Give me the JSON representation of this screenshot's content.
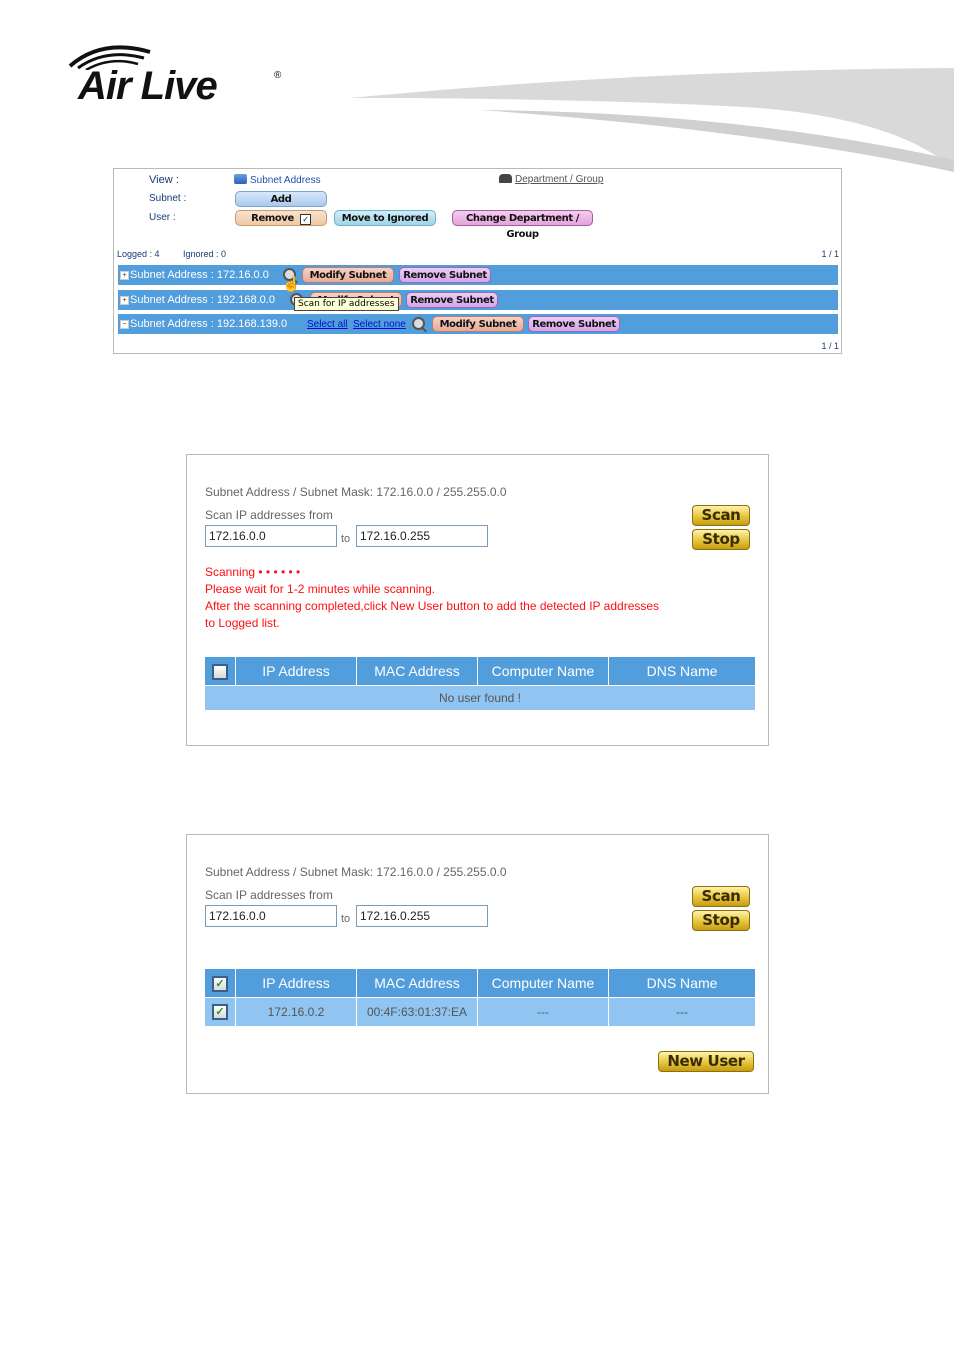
{
  "logo": {
    "brand": "Air Live",
    "registered_mark": "®"
  },
  "panel1": {
    "view_label": "View :",
    "subnet_label": "Subnet :",
    "user_label": "User :",
    "view_subnet_link": "Subnet Address",
    "view_department_link": "Department / Group",
    "add_button": "Add",
    "remove_button": "Remove",
    "remove_checkbox_checked": true,
    "move_ignored_button": "Move to Ignored",
    "change_department_button": "Change Department / Group",
    "logged": "Logged : 4",
    "ignored": "Ignored : 0",
    "pager_top": "1 / 1",
    "pager_bottom": "1 / 1",
    "subnets": [
      {
        "label": "Subnet Address : 172.16.0.0",
        "expander": "+",
        "modify": "Modify Subnet",
        "remove": "Remove Subnet"
      },
      {
        "label": "Subnet Address : 192.168.0.0",
        "expander": "+",
        "modify": "Modify Subnet",
        "remove": "Remove Subnet"
      },
      {
        "label": "Subnet Address : 192.168.139.0",
        "expander": "−",
        "select_all": "Select all",
        "select_none": "Select none",
        "modify": "Modify Subnet",
        "remove": "Remove Subnet"
      }
    ],
    "tooltip": "Scan for IP addresses"
  },
  "scan_panel_1": {
    "subnet_info": "Subnet Address / Subnet Mask: 172.16.0.0 / 255.255.0.0",
    "scan_from_label": "Scan IP addresses from",
    "from_value": "172.16.0.0",
    "to_label": "to",
    "to_value": "172.16.0.255",
    "scan_button": "Scan",
    "stop_button": "Stop",
    "status": "Scanning •    •    •    •    •    •",
    "message1": "Please wait for 1-2 minutes while scanning.",
    "message2": "After the scanning completed,click New User button to add the detected IP addresses",
    "message3": "to Logged list.",
    "columns": [
      "IP Address",
      "MAC Address",
      "Computer Name",
      "DNS Name"
    ],
    "header_checkbox_checked": false,
    "empty_message": "No user found !"
  },
  "scan_panel_2": {
    "subnet_info": "Subnet Address / Subnet Mask: 172.16.0.0 / 255.255.0.0",
    "scan_from_label": "Scan IP addresses from",
    "from_value": "172.16.0.0",
    "to_label": "to",
    "to_value": "172.16.0.255",
    "scan_button": "Scan",
    "stop_button": "Stop",
    "columns": [
      "IP Address",
      "MAC Address",
      "Computer Name",
      "DNS Name"
    ],
    "header_checkbox_checked": true,
    "rows": [
      {
        "checked": true,
        "ip": "172.16.0.2",
        "mac": "00:4F:63:01:37:EA",
        "computer": "---",
        "dns": "---"
      }
    ],
    "new_user_button": "New User"
  }
}
